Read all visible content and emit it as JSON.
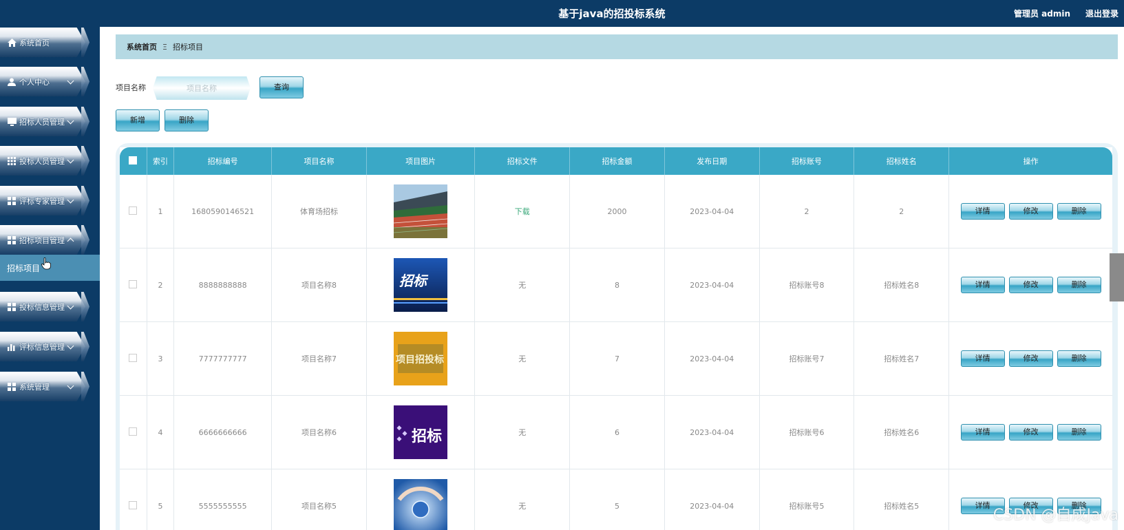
{
  "header": {
    "title": "基于java的招投标系统",
    "user": "管理员 admin",
    "logout": "退出登录"
  },
  "sidebar": {
    "items": [
      {
        "label": "系统首页",
        "icon": "home-icon",
        "chevron": ""
      },
      {
        "label": "个人中心",
        "icon": "user-icon",
        "chevron": "down"
      },
      {
        "label": "招标人员管理",
        "icon": "monitor-icon",
        "chevron": "down"
      },
      {
        "label": "投标人员管理",
        "icon": "grid-icon",
        "chevron": "down"
      },
      {
        "label": "评标专家管理",
        "icon": "grid-icon",
        "chevron": "down"
      },
      {
        "label": "招标项目管理",
        "icon": "grid-icon",
        "chevron": "up"
      },
      {
        "label": "投标信息管理",
        "icon": "grid-icon",
        "chevron": "down"
      },
      {
        "label": "评标信息管理",
        "icon": "bar-chart-icon",
        "chevron": "down"
      },
      {
        "label": "系统管理",
        "icon": "grid-icon",
        "chevron": "down"
      }
    ],
    "sub_active": "招标项目"
  },
  "breadcrumb": {
    "home": "系统首页",
    "separator": "Ξ",
    "current": "招标项目"
  },
  "search": {
    "label": "项目名称",
    "placeholder": "项目名称",
    "button": "查询"
  },
  "actions": {
    "add": "新增",
    "delete": "删除"
  },
  "table": {
    "headers": [
      "索引",
      "招标编号",
      "项目名称",
      "项目图片",
      "招标文件",
      "招标金额",
      "发布日期",
      "招标账号",
      "招标姓名",
      "操作"
    ],
    "rows": [
      {
        "index": "1",
        "code": "1680590146521",
        "name": "体育场招标",
        "image": "stadium-image",
        "file": "下载",
        "amount": "2000",
        "date": "2023-04-04",
        "account": "2",
        "person": "2"
      },
      {
        "index": "2",
        "code": "8888888888",
        "name": "项目名称8",
        "image": "bidding-image",
        "image_text": "招标",
        "file": "无",
        "amount": "8",
        "date": "2023-04-04",
        "account": "招标账号8",
        "person": "招标姓名8"
      },
      {
        "index": "3",
        "code": "7777777777",
        "name": "项目名称7",
        "image": "project-bidding-image",
        "image_text": "项目招投标",
        "file": "无",
        "amount": "7",
        "date": "2023-04-04",
        "account": "招标账号7",
        "person": "招标姓名7"
      },
      {
        "index": "4",
        "code": "6666666666",
        "name": "项目名称6",
        "image": "purple-bidding-image",
        "image_text": "招标",
        "file": "无",
        "amount": "6",
        "date": "2023-04-04",
        "account": "招标账号6",
        "person": "招标姓名6"
      },
      {
        "index": "5",
        "code": "5555555555",
        "name": "项目名称5",
        "image": "hands-image",
        "file": "无",
        "amount": "5",
        "date": "2023-04-04",
        "account": "招标账号5",
        "person": "招标姓名5"
      }
    ],
    "row_actions": {
      "detail": "详情",
      "edit": "修改",
      "delete": "删除"
    }
  },
  "watermark": "CSDN @自成Java"
}
